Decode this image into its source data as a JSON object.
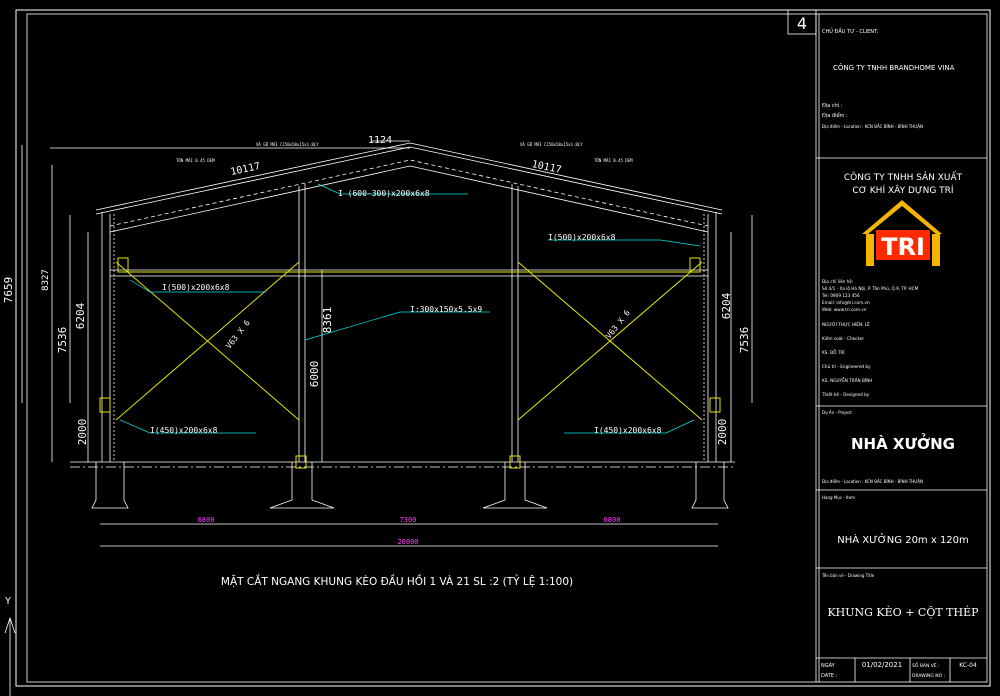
{
  "sheet": {
    "number": "4"
  },
  "title_block": {
    "client_label": "CHỦ ĐẦU TƯ - CLIENT:",
    "client_name": "CÔNG TY TNHH   BRANDHOME VINA",
    "address_label": "Địa chỉ :",
    "address_label2": "Địa điểm :",
    "address_value": "Địa điểm - Location : KCN BẮC BÌNH - BÌNH THUẬN",
    "company_line1": "CÔNG TY TNHH SẢN XUẤT",
    "company_line2": "CƠ KHÍ XÂY DỰNG TRÍ",
    "logo_text": "TRI",
    "contact_lines": [
      "Địa chỉ liên hệ:",
      "Số 4/1 - Xa lộ Hà Nội, P. Tân Phú, Q.9, TP. HCM",
      "Tel: 0909 123 456",
      "Email: info@tri.com.vn",
      "Web: www.tri.com.vn"
    ],
    "design_lines": [
      "NGƯỜI THỰC HIỆN: LÊ",
      "Kiểm soát - Checker",
      "KS. ĐỖ TRÍ",
      "Chủ trì - Engineered by",
      "KS. NGUYỄN TRẦN BÌNH",
      "Thiết kế - Designed by"
    ],
    "project_label": "Dự Án - Project",
    "project_name": "NHÀ XƯỞNG",
    "location_small": "Địa điểm - Location : KCN BẮC BÌNH - BÌNH THUẬN",
    "item_label": "Hạng Mục - Item",
    "item_name": "NHÀ XƯỞNG 20m x 120m",
    "drawing_label": "Tên bản vẽ - Drawing Title",
    "drawing_name": "KHUNG KÈO + CỘT THÉP",
    "date_label": "NGÀY",
    "date_label2": "DATE :",
    "date_value": "01/02/2021",
    "drawing_no_label": "SỐ BẢN VẼ :",
    "drawing_no_label2": "DRAWING NO :",
    "drawing_no_value": "KC-04"
  },
  "drawing": {
    "caption": "MẶT CẮT NGANG KHUNG KÈO ĐẦU HỒI 1 VÀ 21  SL :2 (TỶ LỆ 1:100)",
    "dims_left": [
      "7659",
      "8327",
      "7536",
      "6204",
      "2000"
    ],
    "dims_right": [
      "6204",
      "7536",
      "2000"
    ],
    "dim_roof_left": "10117",
    "dim_roof_right": "10117",
    "dim_ridge": "1124",
    "dim_column": "8361",
    "dim_column2": "6000",
    "dims_bottom": [
      "6800",
      "7300",
      "6800"
    ],
    "dim_total": "20000",
    "labels": {
      "rafter_top": "I (600-300)x200x6x8",
      "rafter_left_end": "I(500)x200x6x8",
      "rafter_right_end": "I(500)x200x6x8",
      "beam": "I:300x150x5.5x9",
      "col_base_left": "I(450)x200x6x8",
      "col_base_right": "I(450)x200x6x8",
      "brace_left": "V63 X 6",
      "brace_right": "V63 X 6",
      "roof_left": "TÔN MÁI 0.45 DEM",
      "roof_right": "TÔN MÁI 0.45 DEM",
      "purlin_left": "XÀ GỒ MÁI C150x50x15x1.8LY",
      "purlin_right": "XÀ GỒ MÁI C150x50x15x1.8LY"
    }
  },
  "ucs": {
    "y": "Y"
  },
  "colors": {
    "line": "#ffffff",
    "yellow": "#e6e600",
    "cyan": "#00e5e5",
    "magenta": "#ff40ff",
    "red": "#ff2a00",
    "gold": "#f4b400"
  }
}
